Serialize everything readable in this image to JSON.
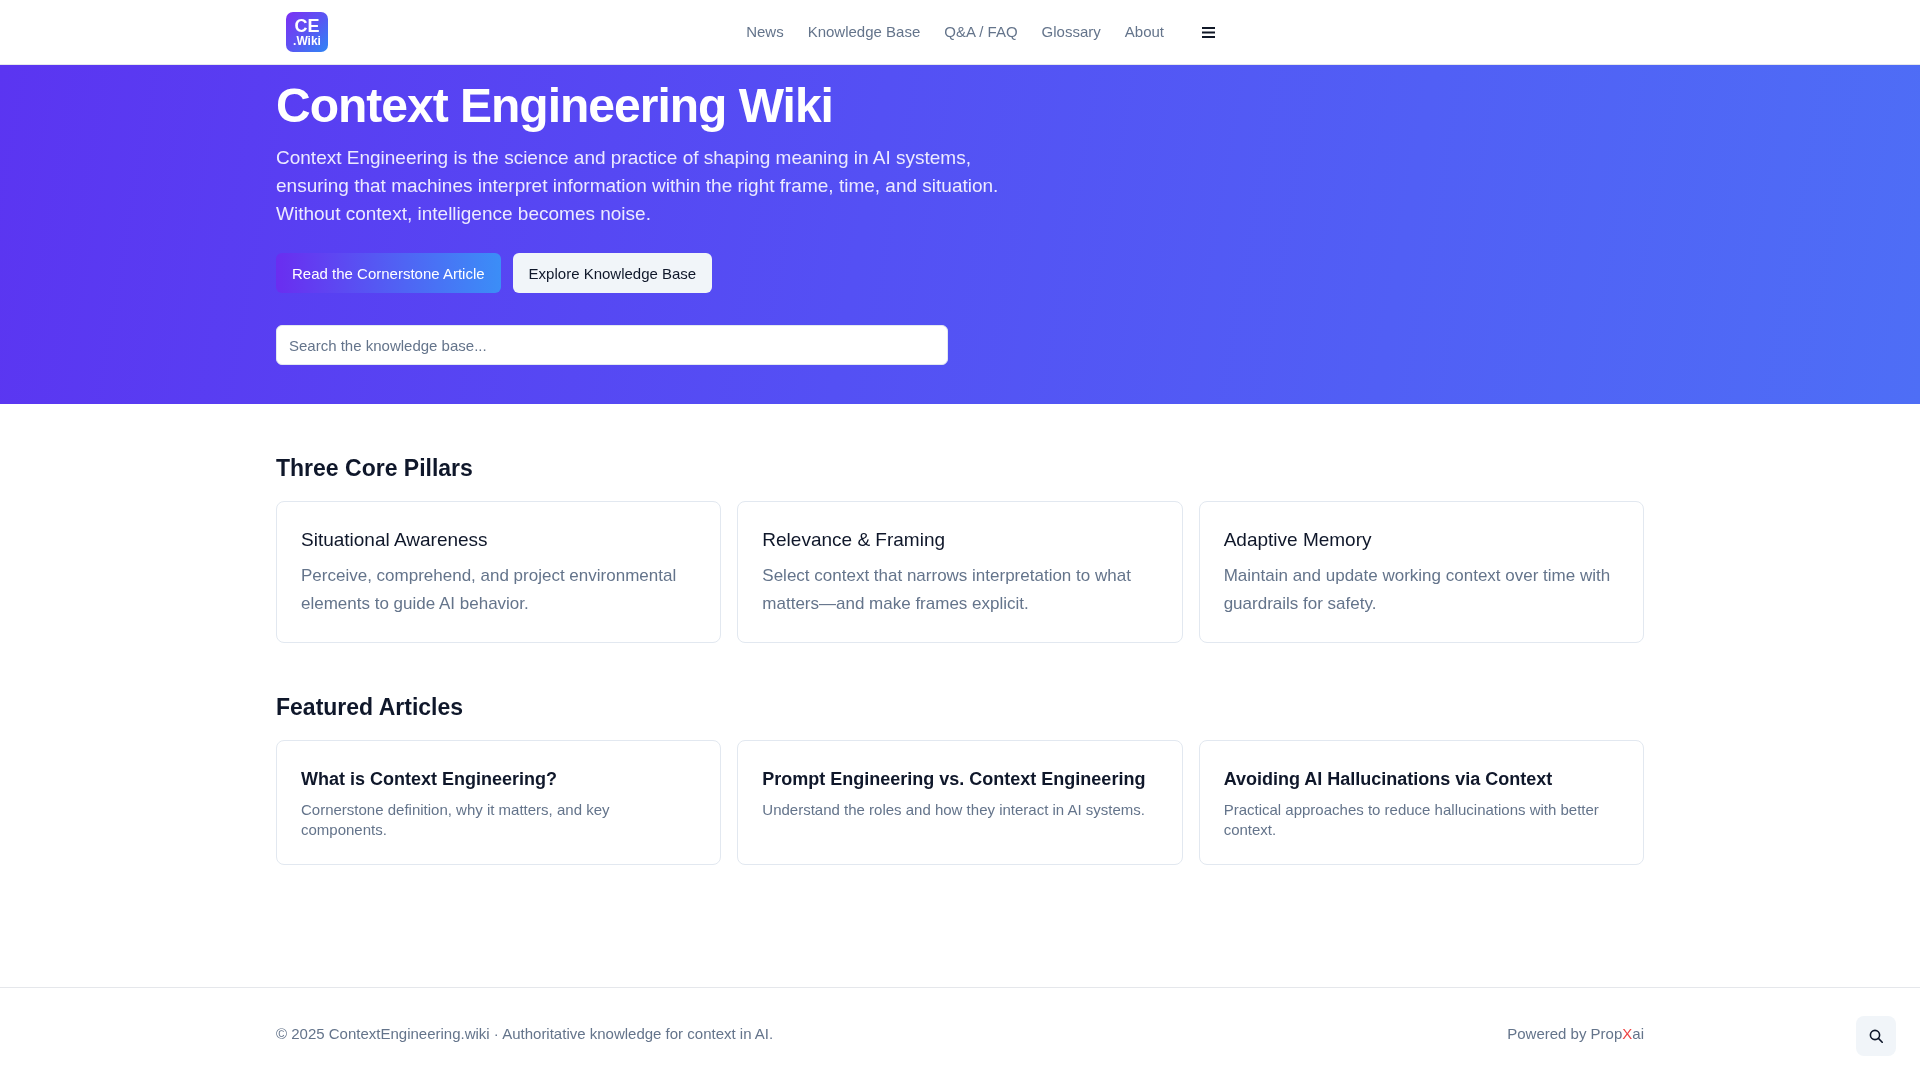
{
  "header": {
    "logo": {
      "line1": "CE",
      "line2": ".Wiki"
    },
    "nav": [
      {
        "label": "News"
      },
      {
        "label": "Knowledge Base"
      },
      {
        "label": "Q&A / FAQ"
      },
      {
        "label": "Glossary"
      },
      {
        "label": "About"
      }
    ]
  },
  "hero": {
    "title": "Context Engineering Wiki",
    "lead": "Context Engineering is the science and practice of shaping meaning in AI systems, ensuring that machines interpret information within the right frame, time, and situation. Without context, intelligence becomes noise.",
    "buttons": [
      {
        "label": "Read the Cornerstone Article",
        "kind": "primary"
      },
      {
        "label": "Explore Knowledge Base",
        "kind": "secondary"
      }
    ],
    "search": {
      "placeholder": "Search the knowledge base..."
    }
  },
  "pillars": {
    "heading": "Three Core Pillars",
    "cards": [
      {
        "title": "Situational Awareness",
        "text": "Perceive, comprehend, and project environmental elements to guide AI behavior."
      },
      {
        "title": "Relevance & Framing",
        "text": "Select context that narrows interpretation to what matters—and make frames explicit."
      },
      {
        "title": "Adaptive Memory",
        "text": "Maintain and update working context over time with guardrails for safety."
      }
    ]
  },
  "featured": {
    "heading": "Featured Articles",
    "cards": [
      {
        "title": "What is Context Engineering?",
        "text": "Cornerstone definition, why it matters, and key components."
      },
      {
        "title": "Prompt Engineering vs. Context Engineering",
        "text": "Understand the roles and how they interact in AI systems."
      },
      {
        "title": "Avoiding AI Hallucinations via Context",
        "text": "Practical approaches to reduce hallucinations with better context."
      }
    ]
  },
  "footer": {
    "copyright": "© 2025 ContextEngineering.wiki · Authoritative knowledge for context in AI.",
    "powered_by": {
      "prefix": "Powered by",
      "brand": [
        {
          "text": "Prop",
          "color": "#64748b"
        },
        {
          "text": "X",
          "color": "#ef4444"
        },
        {
          "text": "ai",
          "color": "#64748b"
        }
      ]
    }
  }
}
